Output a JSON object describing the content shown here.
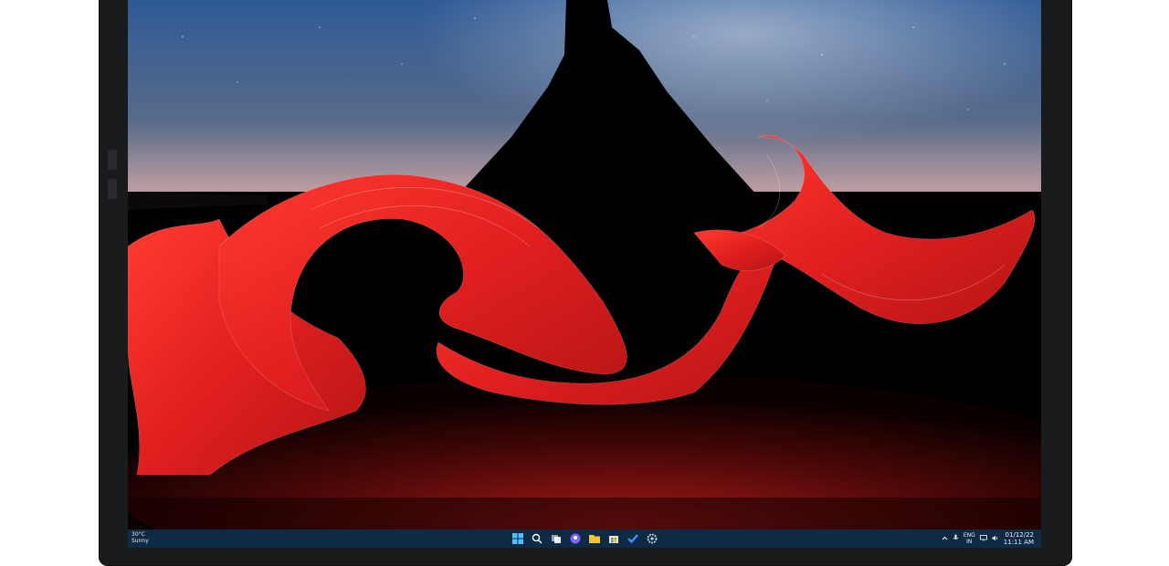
{
  "taskbar": {
    "weather": {
      "temp": "30°C",
      "condition": "Sunny"
    },
    "apps": [
      "windows-start-icon",
      "search-icon",
      "task-view-icon",
      "chat-icon",
      "file-explorer-icon",
      "store-icon",
      "todo-icon",
      "settings-icon"
    ],
    "tray": {
      "lang": "ENG",
      "region": "IN",
      "date": "01/12/22",
      "time": "11:11 AM"
    }
  },
  "colors": {
    "bezel": "#1a1b1d",
    "sky_top": "#2b4f8a",
    "sky_horizon": "#b89da2",
    "ribbon": "#e62b2b",
    "taskbar": "#0f2a45"
  }
}
